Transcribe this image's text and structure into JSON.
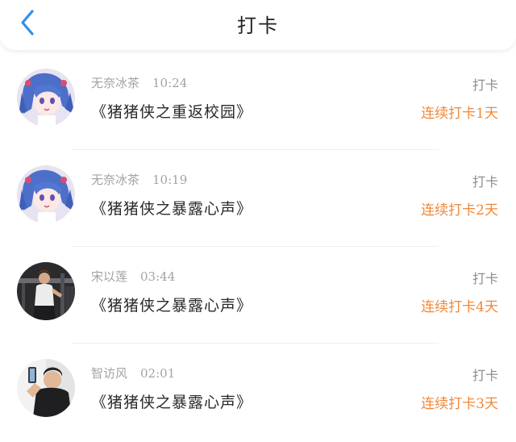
{
  "header": {
    "title": "打卡",
    "back_icon": "chevron-left-icon"
  },
  "colors": {
    "accent_blue": "#2f8fea",
    "streak_orange": "#f0883a"
  },
  "entries": [
    {
      "user": "无奈冰茶",
      "time": "10:24",
      "book": "《猪猪侠之重返校园》",
      "action": "打卡",
      "streak": "连续打卡1天"
    },
    {
      "user": "无奈冰茶",
      "time": "10:19",
      "book": "《猪猪侠之暴露心声》",
      "action": "打卡",
      "streak": "连续打卡2天"
    },
    {
      "user": "宋以莲",
      "time": "03:44",
      "book": "《猪猪侠之暴露心声》",
      "action": "打卡",
      "streak": "连续打卡4天"
    },
    {
      "user": "智访风",
      "time": "02:01",
      "book": "《猪猪侠之暴露心声》",
      "action": "打卡",
      "streak": "连续打卡3天"
    }
  ]
}
